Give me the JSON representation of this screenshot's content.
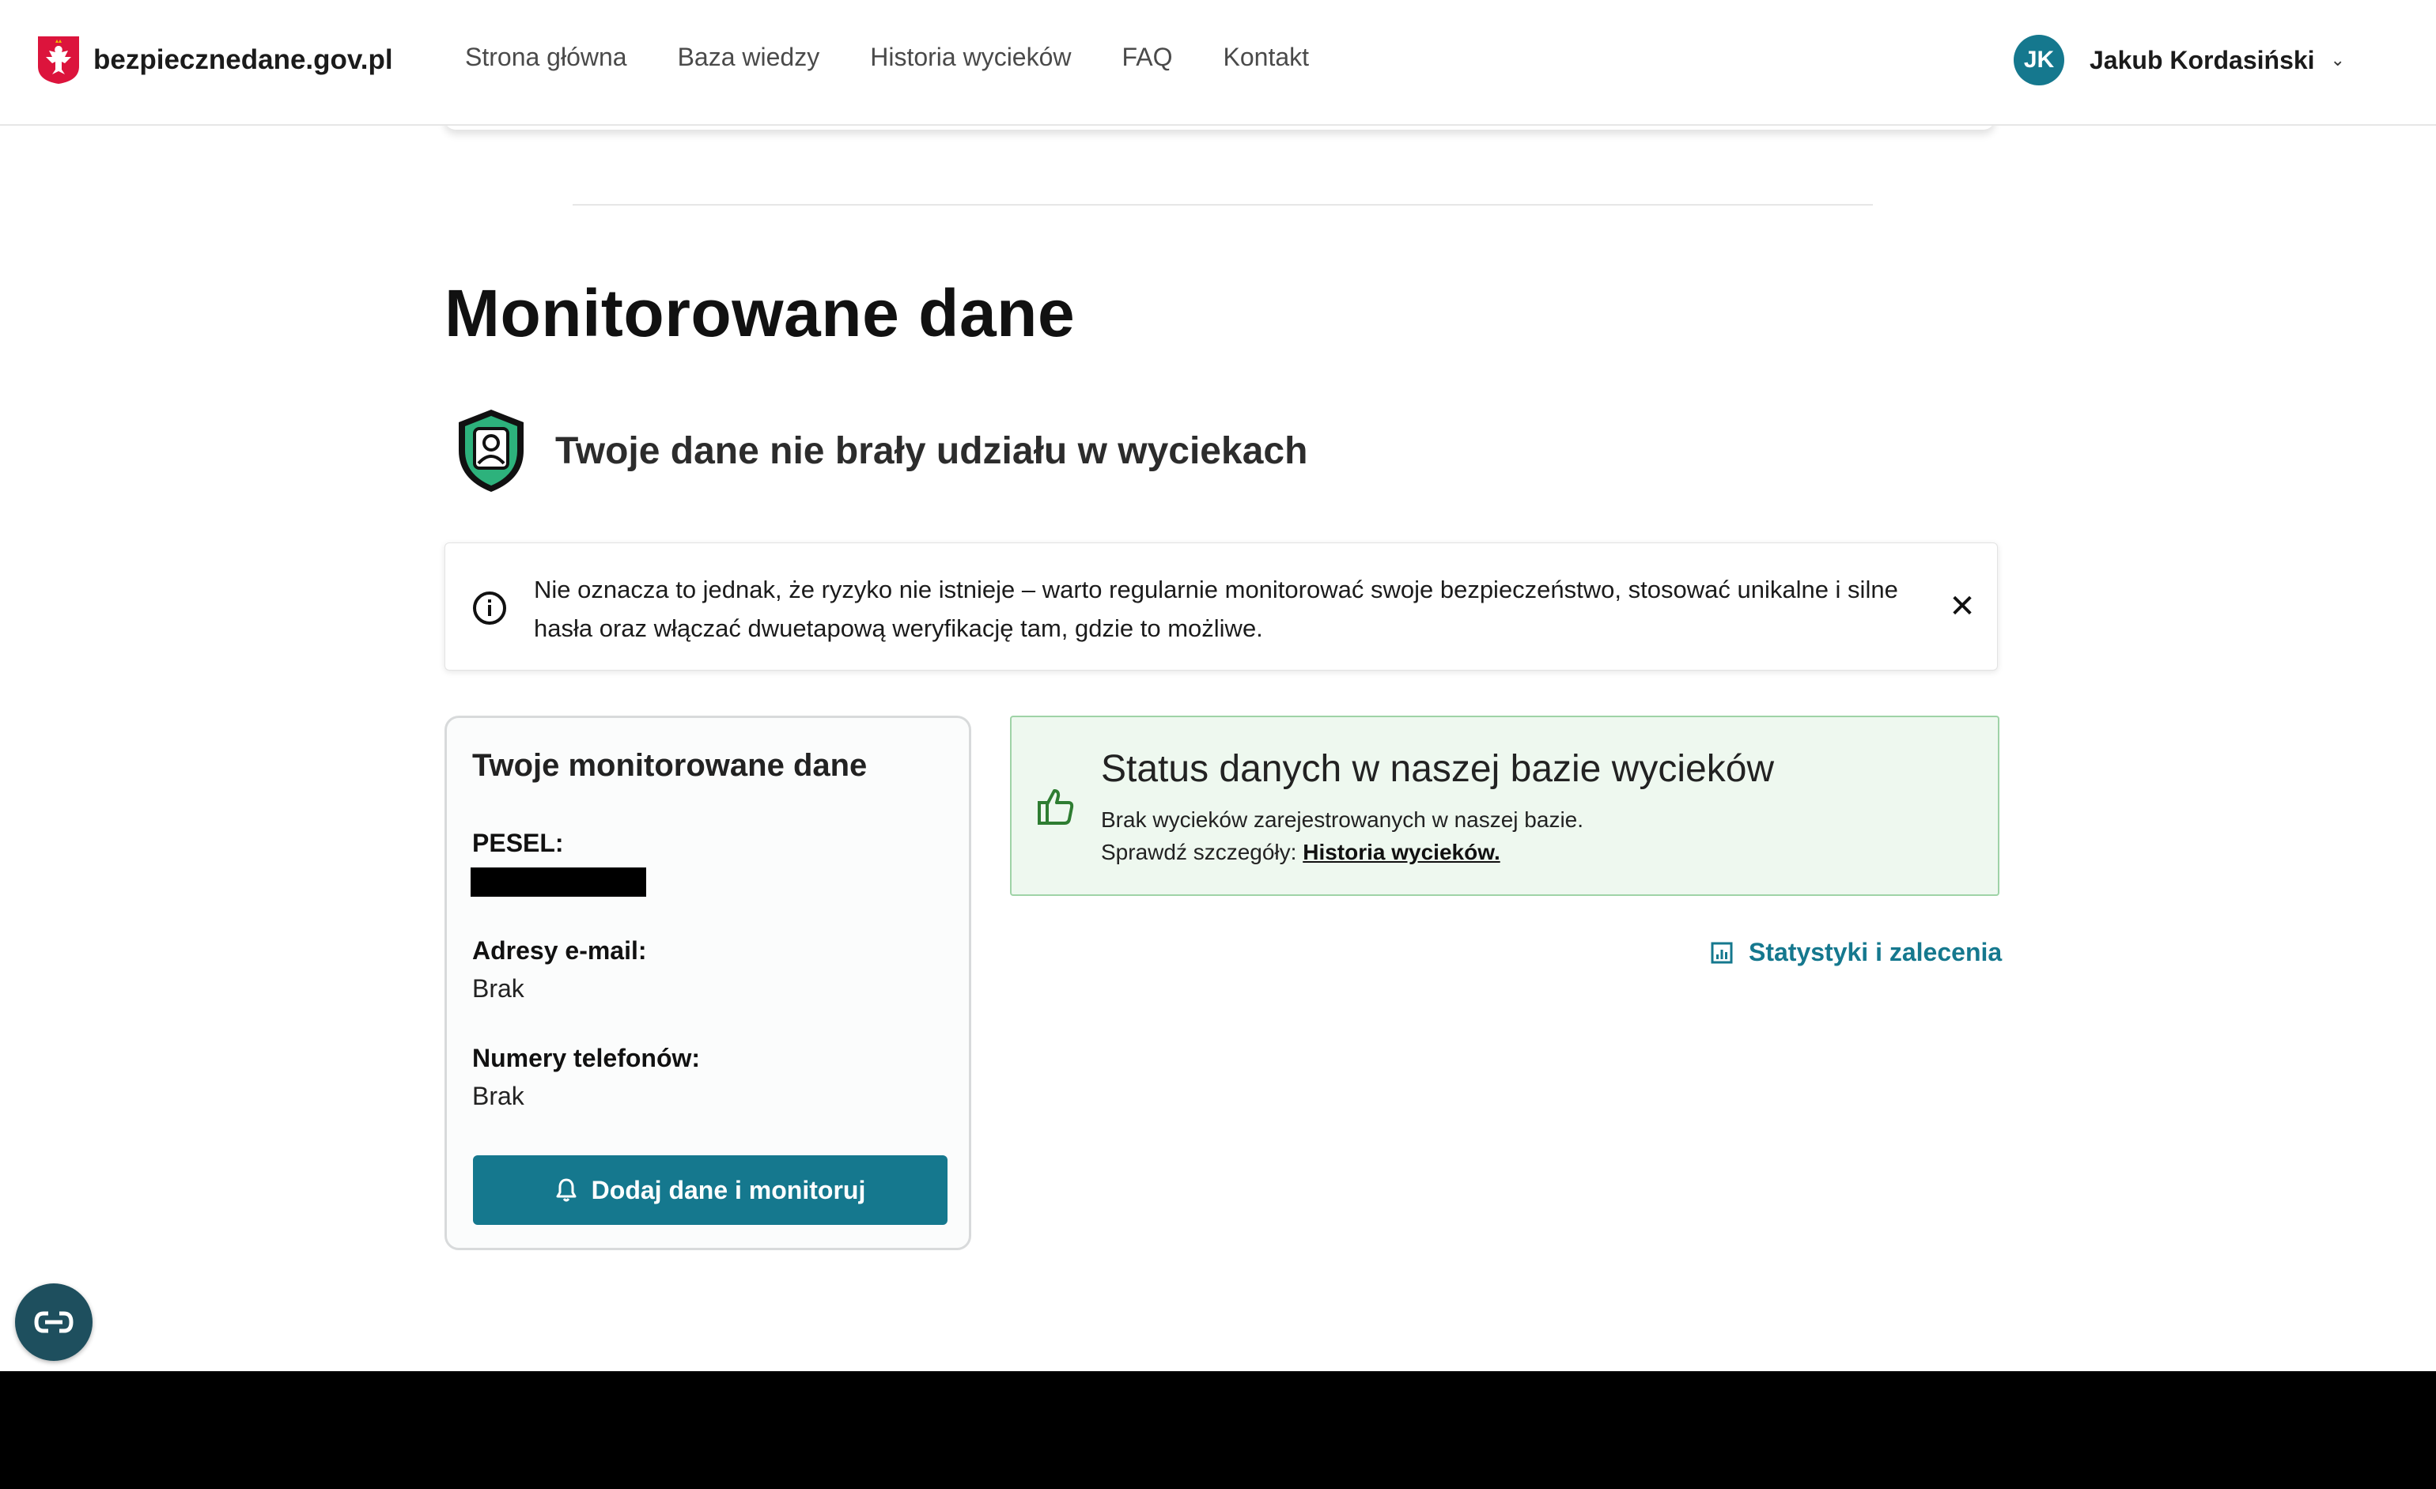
{
  "header": {
    "site_name": "bezpiecznedane.gov.pl",
    "nav": [
      "Strona główna",
      "Baza wiedzy",
      "Historia wycieków",
      "FAQ",
      "Kontakt"
    ],
    "user": {
      "initials": "JK",
      "name": "Jakub Kordasiński"
    }
  },
  "main": {
    "section_title": "Monitorowane dane",
    "status_heading": "Twoje dane nie brały udziału w wyciekach",
    "banner": {
      "text": "Nie oznacza to jednak, że ryzyko nie istnieje – warto regularnie monitorować swoje bezpieczeństwo, stosować unikalne i silne hasła oraz włączać dwuetapową weryfikację tam, gdzie to możliwe.",
      "close_symbol": "✕"
    },
    "monitored_card": {
      "title": "Twoje monitorowane dane",
      "pesel_label": "PESEL:",
      "email_label": "Adresy e-mail:",
      "email_value": "Brak",
      "phone_label": "Numery telefonów:",
      "phone_value": "Brak",
      "button_label": "Dodaj dane i monitoruj"
    },
    "status_box": {
      "title": "Status danych w naszej bazie wycieków",
      "line1": "Brak wycieków zarejestrowanych w naszej bazie.",
      "line2_prefix": "Sprawdź szczegóły:",
      "line2_link": "Historia wycieków."
    },
    "stats_link": "Statystyki i zalecenia"
  },
  "colors": {
    "accent": "#15788e",
    "status_bg": "#eef8ef",
    "status_border": "#9fd3a7",
    "shield_green": "#2db27c"
  },
  "icons": [
    "poland-emblem-icon",
    "shield-user-icon",
    "info-icon",
    "close-icon",
    "thumbs-up-icon",
    "bell-icon",
    "chart-icon",
    "accessibility-icon",
    "chevron-down-icon"
  ]
}
